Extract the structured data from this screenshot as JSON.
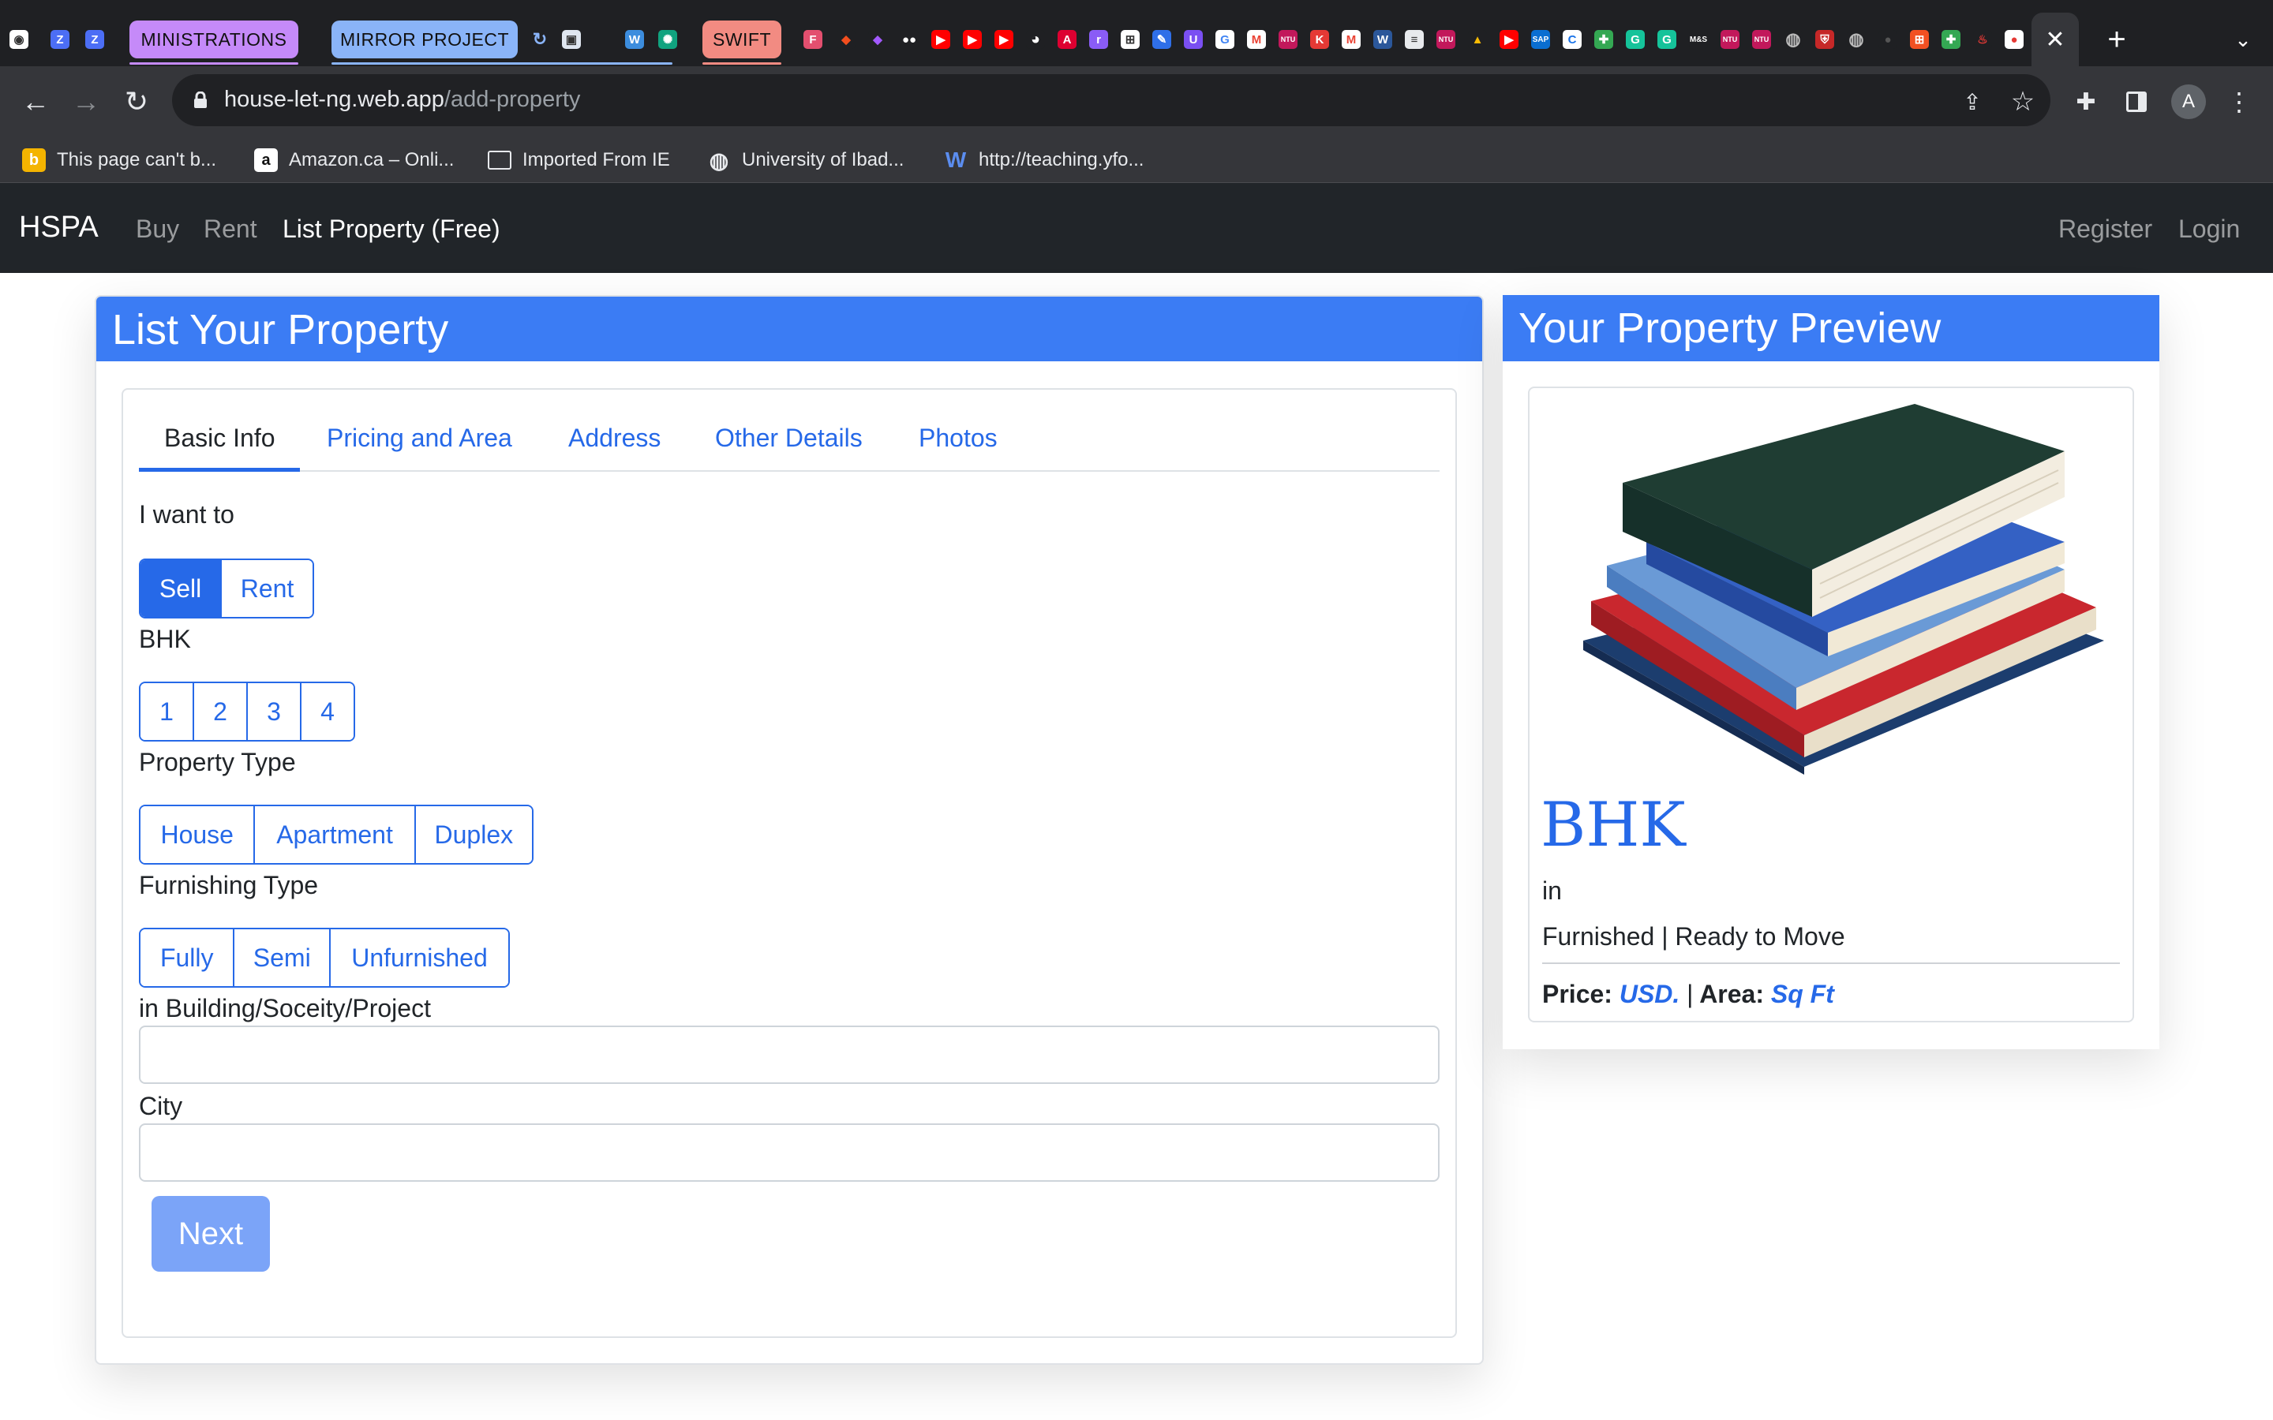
{
  "browser": {
    "tab_groups": [
      {
        "label": "MINISTRATIONS",
        "color": "#c58af9"
      },
      {
        "label": "MIRROR PROJECT",
        "color": "#8ab4f8"
      },
      {
        "label": "SWIFT",
        "color": "#f28b82"
      }
    ],
    "active_tab_close": "✕",
    "new_tab": "+",
    "url_host": "house-let-ng.web.app",
    "url_path": "/add-property",
    "profile_initial": "A",
    "bookmarks": [
      {
        "label": "This page can't b...",
        "icon": "bing-icon"
      },
      {
        "label": "Amazon.ca – Onli...",
        "icon": "amazon-icon"
      },
      {
        "label": "Imported From IE",
        "icon": "folder-icon"
      },
      {
        "label": "University of Ibad...",
        "icon": "globe-icon"
      },
      {
        "label": "http://teaching.yfo...",
        "icon": "webs-icon"
      }
    ]
  },
  "navbar": {
    "brand": "HSPA",
    "links": [
      "Buy",
      "Rent",
      "List Property (Free)"
    ],
    "register": "Register",
    "login": "Login"
  },
  "form": {
    "title": "List Your Property",
    "tabs": [
      "Basic Info",
      "Pricing and Area",
      "Address",
      "Other Details",
      "Photos"
    ],
    "active_tab": "Basic Info",
    "want_label": "I want to",
    "want_options": [
      "Sell",
      "Rent"
    ],
    "want_selected": "Sell",
    "bhk_label": "BHK",
    "bhk_options": [
      "1",
      "2",
      "3",
      "4"
    ],
    "ptype_label": "Property Type",
    "ptype_options": [
      "House",
      "Apartment",
      "Duplex"
    ],
    "furnish_label": "Furnishing Type",
    "furnish_options": [
      "Fully",
      "Semi",
      "Unfurnished"
    ],
    "building_label": "in Building/Soceity/Project",
    "building_value": "",
    "city_label": "City",
    "city_value": "",
    "next": "Next"
  },
  "preview": {
    "title": "Your Property Preview",
    "bhk": "BHK",
    "in": "in",
    "status": "Furnished | Ready to Move",
    "price_label": "Price:",
    "price_unit": "USD.",
    "area_label": "Area:",
    "area_unit": "Sq Ft"
  }
}
